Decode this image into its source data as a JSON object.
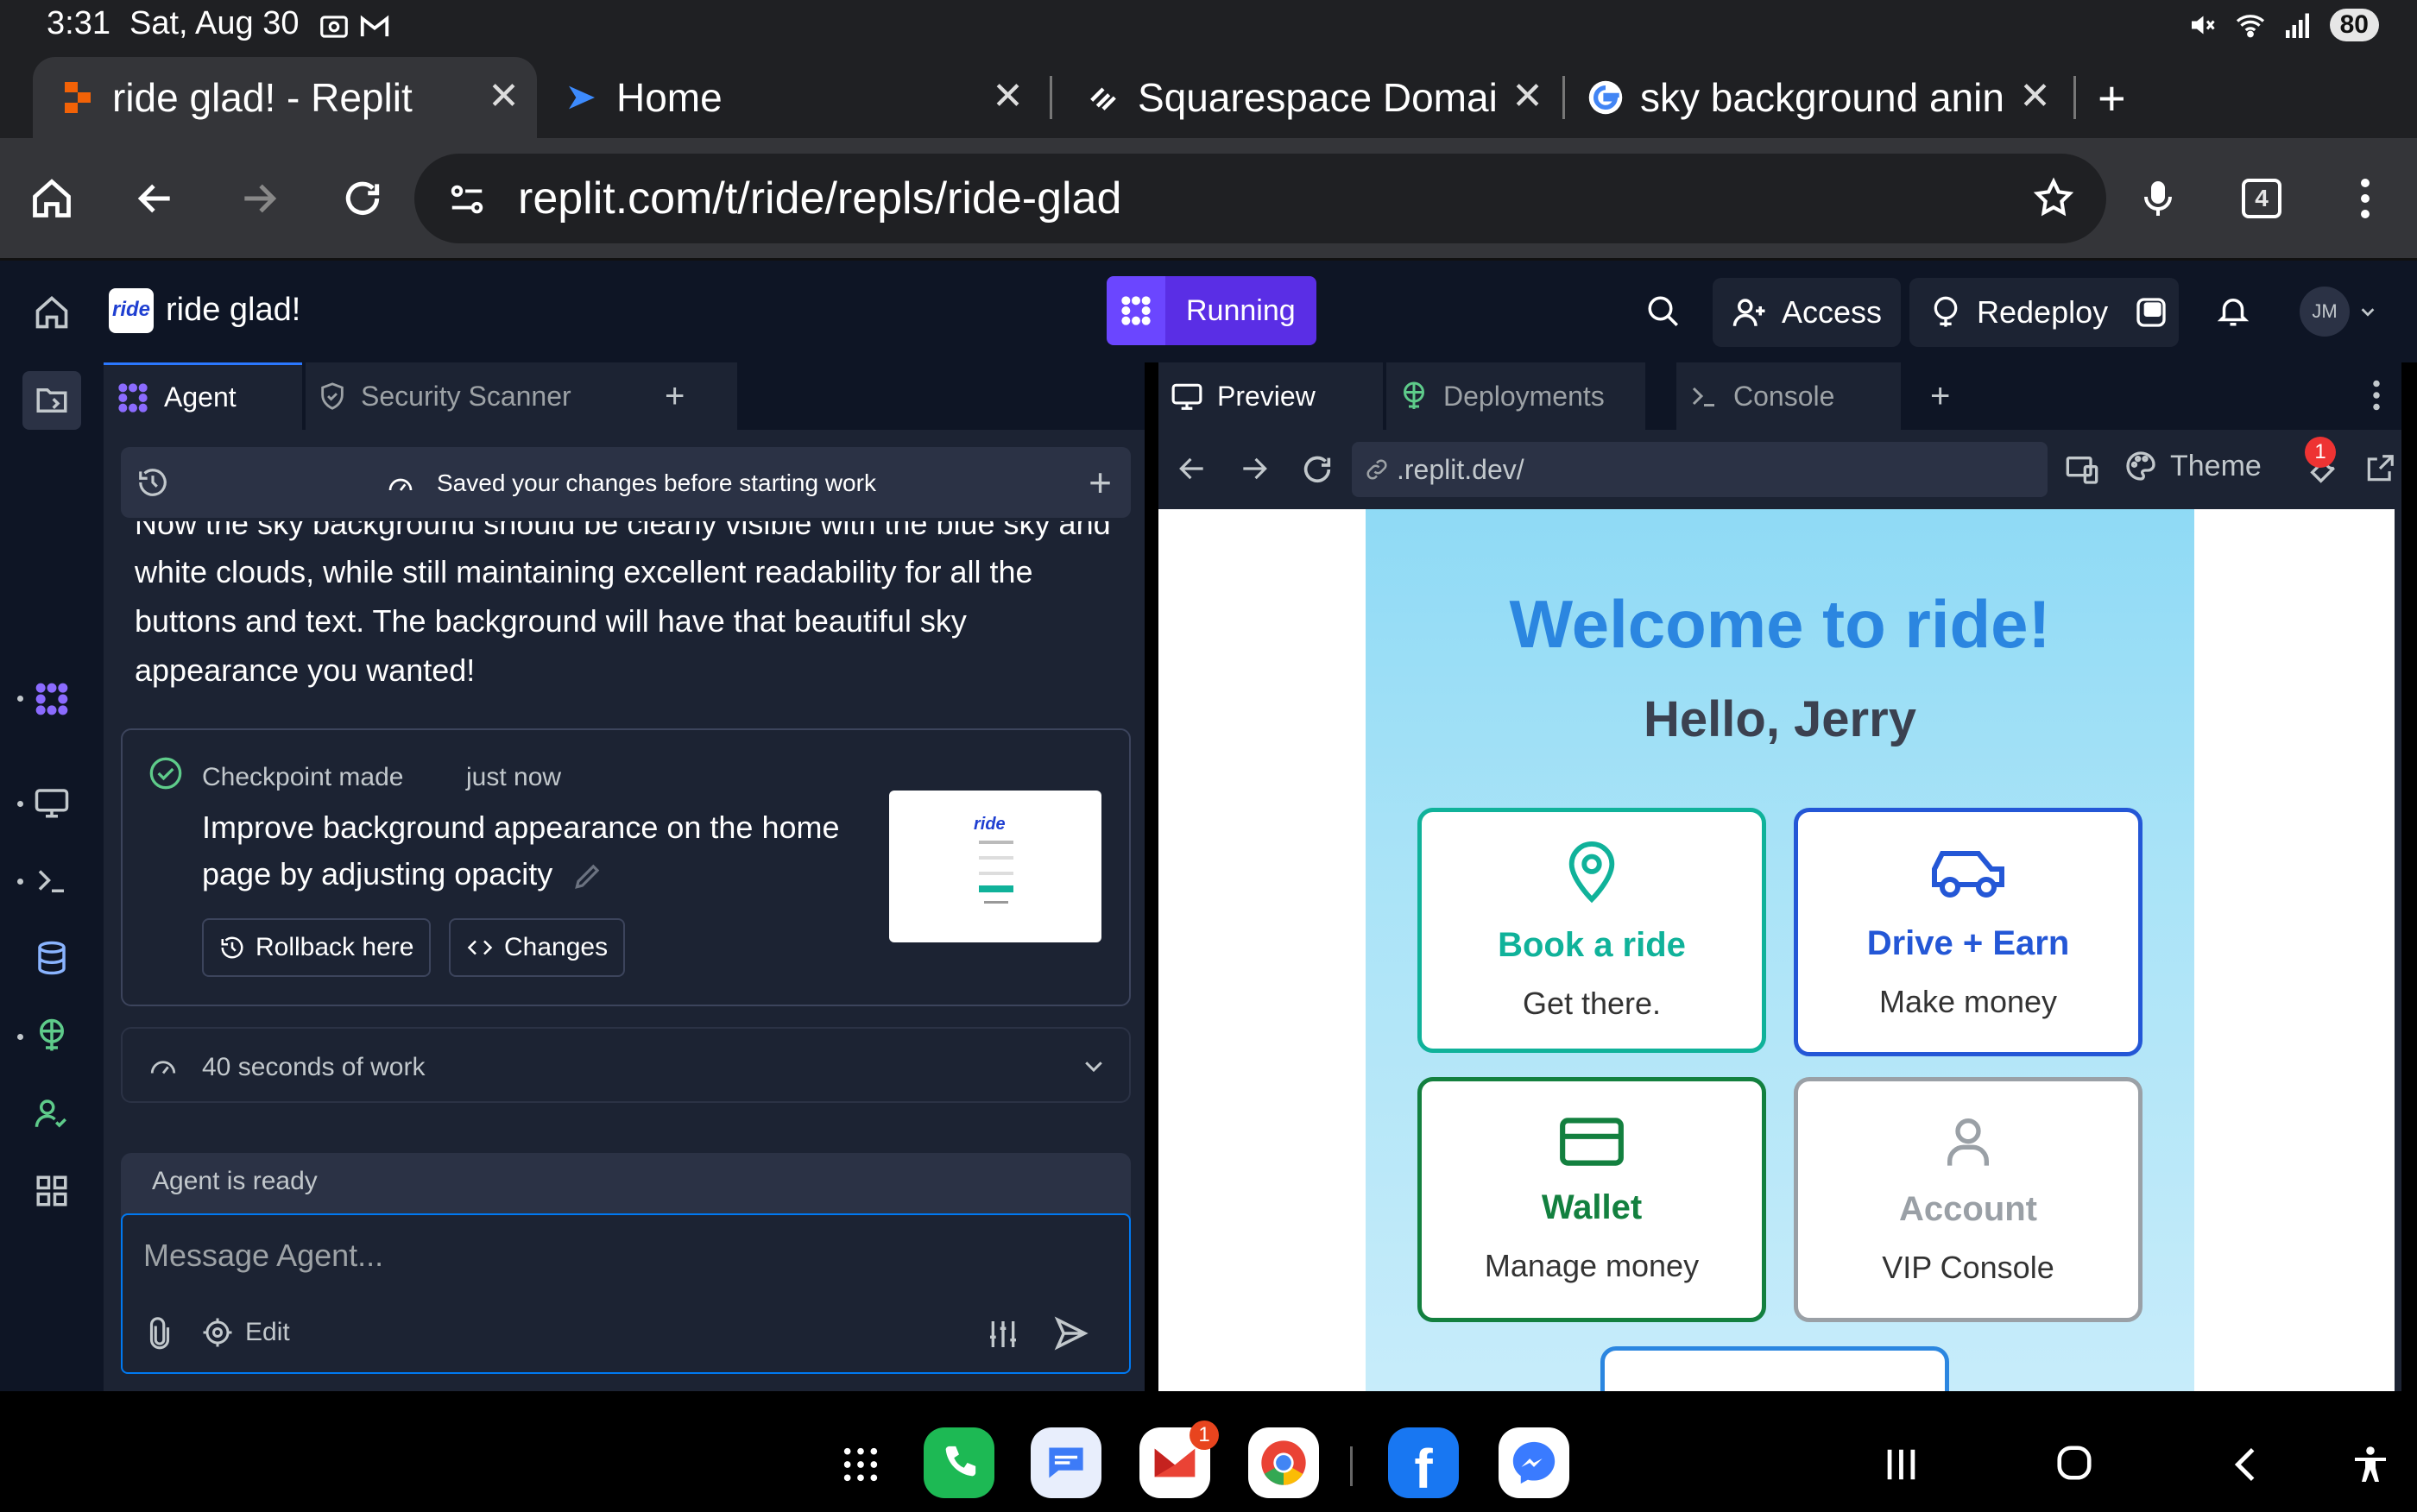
{
  "status": {
    "time": "3:31",
    "date": "Sat, Aug 30",
    "battery": "80"
  },
  "browser_tabs": [
    {
      "title": "ride glad! - Replit",
      "icon": "replit-icon"
    },
    {
      "title": "Home",
      "icon": "arrow-logo-icon"
    },
    {
      "title": "Squarespace Domai",
      "icon": "squarespace-icon"
    },
    {
      "title": "sky background anin",
      "icon": "google-icon"
    }
  ],
  "tab_count": "4",
  "url": "replit.com/t/ride/repls/ride-glad",
  "replit": {
    "app_logo": "ride",
    "app_name": "ride glad!",
    "status": "Running",
    "access_label": "Access",
    "redeploy_label": "Redeploy",
    "avatar": "JM"
  },
  "agent_panel": {
    "tabs": [
      "Agent",
      "Security Scanner"
    ],
    "saved_notice": "Saved your changes before starting work",
    "message_lines": [
      "Now the sky background should be clearly visible with the blue sky and",
      "white clouds, while still maintaining excellent readability for all the",
      "buttons and text. The background will have that beautiful sky",
      "appearance you wanted!"
    ],
    "checkpoint": {
      "status": "Checkpoint made",
      "time": "just now",
      "title_line1": "Improve background appearance on the home",
      "title_line2": "page by adjusting opacity",
      "rollback_label": "Rollback here",
      "changes_label": "Changes"
    },
    "work_summary": "40 seconds of work",
    "ready_text": "Agent is ready",
    "input_placeholder": "Message Agent...",
    "edit_label": "Edit"
  },
  "right_panel": {
    "tabs": [
      "Preview",
      "Deployments",
      "Console"
    ],
    "preview_url": ".replit.dev/",
    "theme_label": "Theme",
    "notif_badge": "1"
  },
  "preview_page": {
    "welcome": "Welcome to ride!",
    "hello": "Hello, Jerry",
    "cards": [
      {
        "title": "Book a ride",
        "subtitle": "Get there.",
        "icon": "location-pin-icon",
        "color": "#10b29a"
      },
      {
        "title": "Drive + Earn",
        "subtitle": "Make money",
        "icon": "car-icon",
        "color": "#2457d6"
      },
      {
        "title": "Wallet",
        "subtitle": "Manage money",
        "icon": "credit-card-icon",
        "color": "#13803f"
      },
      {
        "title": "Account",
        "subtitle": "VIP Console",
        "icon": "user-icon",
        "color": "#9aa0a6"
      }
    ]
  },
  "dock": {
    "gmail_badge": "1"
  },
  "colors": {
    "accent": "#0079f2",
    "running": "#5a2ee5",
    "editor_bg": "#1c2333",
    "header_bg": "#0e1525"
  }
}
